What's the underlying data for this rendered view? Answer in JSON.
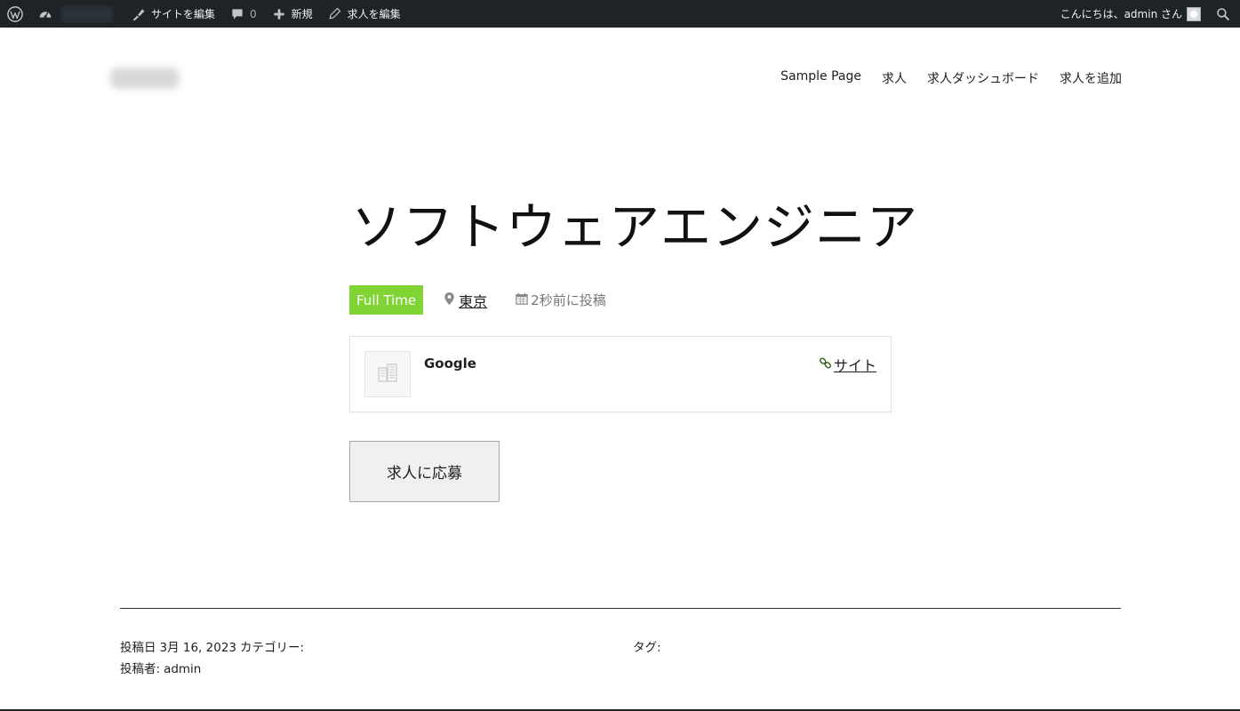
{
  "adminbar": {
    "edit_site": "サイトを編集",
    "comments_count": "0",
    "new_label": "新規",
    "edit_job": "求人を編集",
    "greeting": "こんにちは、admin さん"
  },
  "nav": {
    "items": [
      "Sample Page",
      "求人",
      "求人ダッシュボード",
      "求人を追加"
    ]
  },
  "job": {
    "title": "ソフトウェアエンジニア",
    "type_badge": "Full Time",
    "location": "東京",
    "posted": "2秒前に投稿",
    "company": {
      "name": "Google",
      "site_label": "サイト"
    },
    "apply_label": "求人に応募"
  },
  "post_meta": {
    "date_label": "投稿日",
    "date": "3月 16, 2023",
    "category_label": "カテゴリー:",
    "author_label": "投稿者:",
    "author": "admin",
    "tags_label": "タグ:"
  },
  "colors": {
    "adminbar_bg": "#1d2327",
    "badge_bg": "#80d534"
  }
}
